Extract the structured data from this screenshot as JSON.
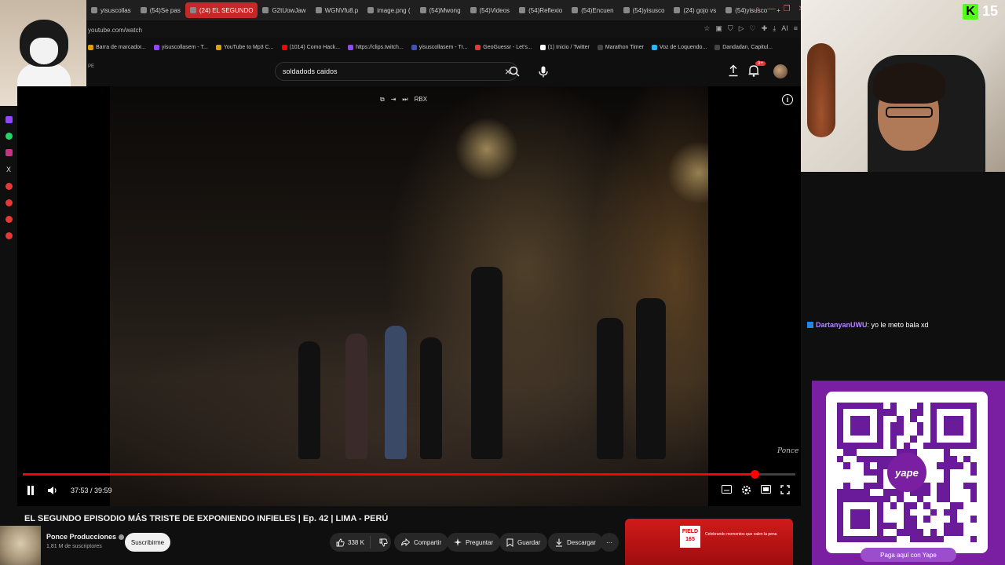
{
  "browser": {
    "tabs": [
      {
        "label": "yisuscollas",
        "active": false
      },
      {
        "label": "(54)Se pas",
        "active": false
      },
      {
        "label": "(24) EL SEGUNDO",
        "active": true
      },
      {
        "label": "G2tUowJaw",
        "active": false
      },
      {
        "label": "WGNVfu8.p",
        "active": false
      },
      {
        "label": "image.png (",
        "active": false
      },
      {
        "label": "(54)Mwong",
        "active": false
      },
      {
        "label": "(54)Videos",
        "active": false
      },
      {
        "label": "(54)Reflexio",
        "active": false
      },
      {
        "label": "(54)Encuen",
        "active": false
      },
      {
        "label": "(54)yisusco",
        "active": false
      },
      {
        "label": "(24) gojo vs",
        "active": false
      },
      {
        "label": "(54)yisusco",
        "active": false
      }
    ],
    "new_tab": "+",
    "url": "youtube.com/watch",
    "bookmarks": [
      {
        "label": "Barra de marcador...",
        "color": "#e0a000"
      },
      {
        "label": "yisuscollasem - T...",
        "color": "#9146ff"
      },
      {
        "label": "YouTube to Mp3 C...",
        "color": "#e0a000"
      },
      {
        "label": "(1014) Como Hack...",
        "color": "#ff0000"
      },
      {
        "label": "https://clips.twitch...",
        "color": "#9146ff"
      },
      {
        "label": "yisuscollasem - Tr...",
        "color": "#3f51b5"
      },
      {
        "label": "GeoGuessr - Let's...",
        "color": "#e53935"
      },
      {
        "label": "(1) Inicio / Twitter",
        "color": "#ffffff"
      },
      {
        "label": "Marathon Timer",
        "color": "#444444"
      },
      {
        "label": "Voz de Loquendo...",
        "color": "#29b6f6"
      },
      {
        "label": "Dandadan, Capitul...",
        "color": "#444444"
      }
    ]
  },
  "header": {
    "country_code": "PE",
    "search_value": "soldadods caidos",
    "notification_count": "9+"
  },
  "video": {
    "time_display": "37:53 / 39:59",
    "progress": 0.9475,
    "overlay_label": "RBX",
    "watermark": "Ponce"
  },
  "details": {
    "title": "EL SEGUNDO EPISODIO MÁS TRISTE DE EXPONIENDO INFIELES | Ep. 42 | LIMA - PERÚ",
    "channel_name": "Ponce Producciones",
    "subscribers": "1,81 M de suscriptores",
    "subscribe_label": "Suscribirme",
    "likes": "338 K",
    "share_label": "Compartir",
    "ask_label": "Preguntar",
    "save_label": "Guardar",
    "download_label": "Descargar"
  },
  "ad": {
    "brand": "FIELD 165",
    "tagline": "Celebrando momentos que valen la pena"
  },
  "stream": {
    "viewer_count": "15",
    "chat": {
      "user": "DartanyanUWU",
      "message": ": yo le meto bala xd"
    },
    "yape_cta": "Paga aquí con Yape",
    "yape_logo": "yape"
  },
  "colors": {
    "accent_red": "#ff0000",
    "kick_green": "#53fc18",
    "yape_purple": "#7b1fa2"
  }
}
